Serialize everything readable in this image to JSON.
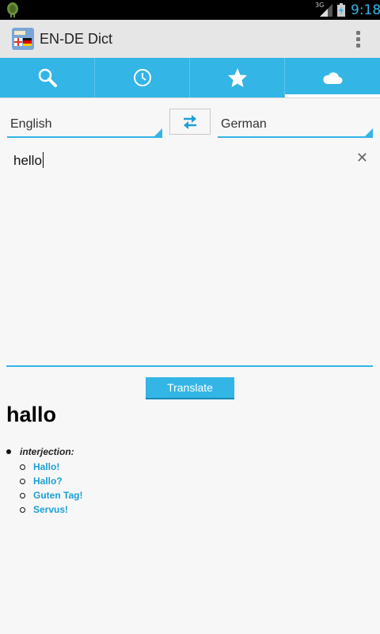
{
  "status_bar": {
    "network_type": "3G",
    "time": "9:18",
    "icons": [
      "android-debug-icon",
      "signal-icon",
      "battery-icon"
    ]
  },
  "app": {
    "title": "EN-DE Dict",
    "icon": "app-flag-icon"
  },
  "tabs": [
    {
      "icon": "search-icon",
      "selected": false
    },
    {
      "icon": "history-clock-icon",
      "selected": false
    },
    {
      "icon": "favorites-star-icon",
      "selected": false
    },
    {
      "icon": "cloud-icon",
      "selected": true
    }
  ],
  "languages": {
    "source": "English",
    "target": "German",
    "swap_icon": "swap-arrows-icon"
  },
  "input": {
    "value": "hello"
  },
  "translate_button": "Translate",
  "result": {
    "word": "hallo",
    "part_of_speech": "interjection:",
    "translations": [
      "Hallo!",
      "Hallo?",
      "Guten Tag!",
      "Servus!"
    ]
  },
  "colors": {
    "accent": "#33b5e5",
    "link": "#1ba1d6",
    "status_bar": "#000000",
    "action_bar": "#e6e6e6"
  }
}
